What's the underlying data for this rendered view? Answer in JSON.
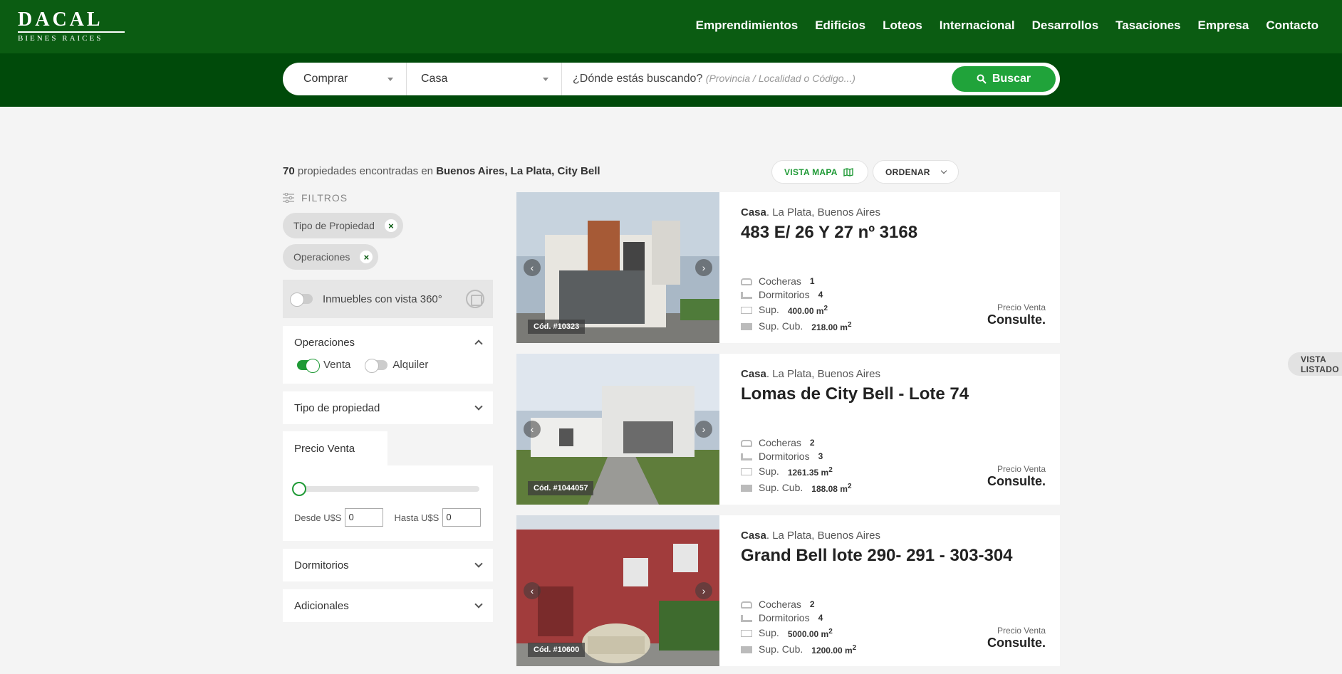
{
  "brand": {
    "name": "DACAL",
    "tagline": "BIENES RAICES"
  },
  "nav": [
    "Emprendimientos",
    "Edificios",
    "Loteos",
    "Internacional",
    "Desarrollos",
    "Tasaciones",
    "Empresa",
    "Contacto"
  ],
  "search": {
    "operation": "Comprar",
    "property_type": "Casa",
    "query_label": "¿Dónde estás buscando?",
    "query_hint": "(Provincia / Localidad o Código...)",
    "button": "Buscar"
  },
  "results": {
    "count": "70",
    "text": "propiedades encontradas en",
    "location": "Buenos Aires, La Plata, City Bell"
  },
  "views": {
    "map": "VISTA MAPA",
    "list": "VISTA LISTADO",
    "order": "ORDENAR"
  },
  "filters": {
    "title": "FILTROS",
    "chips": [
      "Tipo de Propiedad",
      "Operaciones"
    ],
    "vista360": "Inmuebles con vista 360°",
    "operaciones": {
      "title": "Operaciones",
      "venta": "Venta",
      "alquiler": "Alquiler"
    },
    "tipo": "Tipo de propiedad",
    "precio": {
      "tab": "Precio Venta",
      "desde": "Desde U$S",
      "hasta": "Hasta U$S",
      "desde_val": "0",
      "hasta_val": "0"
    },
    "dormitorios": "Dormitorios",
    "adicionales": "Adicionales"
  },
  "labels": {
    "cocheras": "Cocheras",
    "dormitorios": "Dormitorios",
    "sup": "Sup.",
    "supcub": "Sup. Cub.",
    "precio": "Precio Venta",
    "consulte": "Consulte."
  },
  "listings": [
    {
      "tipo": "Casa",
      "loc": ". La Plata, Buenos Aires",
      "title": "483 E/ 26 Y 27 nº 3168",
      "cod": "Cód. #10323",
      "cocheras": "1",
      "dormitorios": "4",
      "sup": "400.00 m",
      "supcub": "218.00 m"
    },
    {
      "tipo": "Casa",
      "loc": ". La Plata, Buenos Aires",
      "title": "Lomas de City Bell - Lote 74",
      "cod": "Cód. #1044057",
      "cocheras": "2",
      "dormitorios": "3",
      "sup": "1261.35 m",
      "supcub": "188.08 m"
    },
    {
      "tipo": "Casa",
      "loc": ". La Plata, Buenos Aires",
      "title": "Grand Bell lote 290- 291 - 303-304",
      "cod": "Cód. #10600",
      "cocheras": "2",
      "dormitorios": "4",
      "sup": "5000.00 m",
      "supcub": "1200.00 m"
    }
  ],
  "colors": {
    "header": "#0b5c12",
    "searchbar": "#004a0a",
    "accent": "#20a33a"
  }
}
